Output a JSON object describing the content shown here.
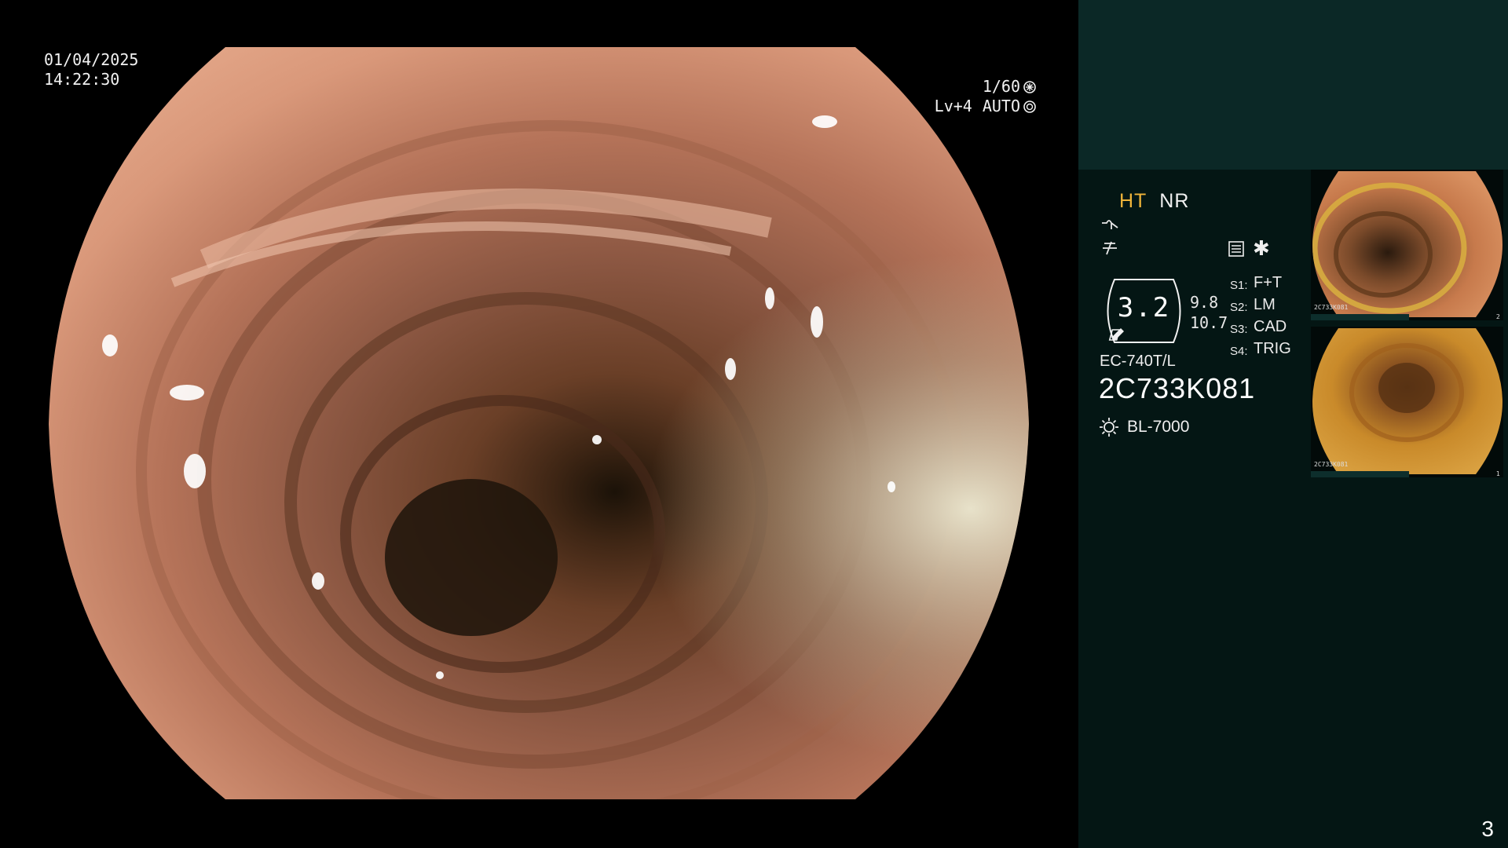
{
  "overlay": {
    "date": "01/04/2025",
    "time": "14:22:30",
    "shutter": "1/60",
    "level": "Lv+4",
    "iris_mode": "AUTO"
  },
  "panel": {
    "mode_ht": "HT",
    "mode_nr": "NR",
    "gauge_value": "3.2",
    "side_value_1": "9.8",
    "side_value_2": "10.7",
    "switches": [
      {
        "key": "S1:",
        "value": "F+T"
      },
      {
        "key": "S2:",
        "value": "LM"
      },
      {
        "key": "S3:",
        "value": "CAD"
      },
      {
        "key": "S4:",
        "value": "TRIG"
      }
    ],
    "scope_model": "EC-740T/L",
    "scope_serial": "2C733K081",
    "light_source": "BL-7000",
    "page_number": "3"
  },
  "thumbnails": [
    {
      "label": "2C733K081",
      "index": "2"
    },
    {
      "label": "2C733K081",
      "index": "1"
    }
  ],
  "colors": {
    "panel_bg": "#041614",
    "panel_top": "#0b2826",
    "accent_ht": "#f0b43a"
  }
}
